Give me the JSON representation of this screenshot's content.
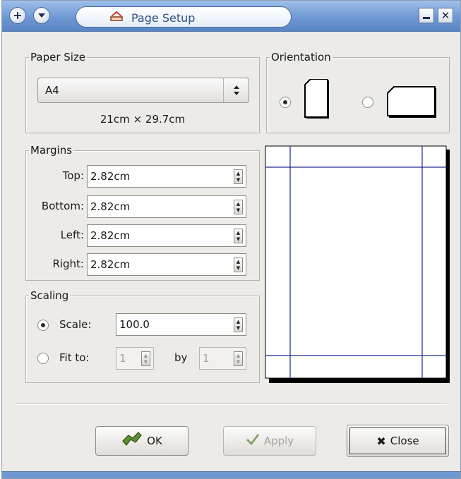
{
  "window": {
    "title": "Page Setup"
  },
  "paper_size": {
    "label": "Paper Size",
    "selected": "A4",
    "dimensions": "21cm × 29.7cm"
  },
  "orientation": {
    "label": "Orientation",
    "selected": "portrait",
    "options": [
      "portrait",
      "landscape"
    ]
  },
  "margins": {
    "label": "Margins",
    "rows": [
      {
        "label": "Top:",
        "value": "2.82cm"
      },
      {
        "label": "Bottom:",
        "value": "2.82cm"
      },
      {
        "label": "Left:",
        "value": "2.82cm"
      },
      {
        "label": "Right:",
        "value": "2.82cm"
      }
    ]
  },
  "scaling": {
    "label": "Scaling",
    "selected": "scale",
    "scale_label": "Scale:",
    "scale_value": "100.0",
    "fit_label": "Fit to:",
    "fit_value_1": "1",
    "by_label": "by",
    "fit_value_2": "1"
  },
  "buttons": {
    "ok": "OK",
    "apply": "Apply",
    "close": "Close"
  },
  "colors": {
    "titlebar": "#6e98d3",
    "preview_lines": "#1f2a8c",
    "dialog_bg": "#edebe8"
  },
  "icons": [
    "plus-icon",
    "menu-down-icon",
    "page-setup-icon",
    "minimize-icon",
    "close-icon",
    "updown-arrows-icon",
    "ok-icon",
    "apply-check-icon",
    "close-x-icon"
  ]
}
